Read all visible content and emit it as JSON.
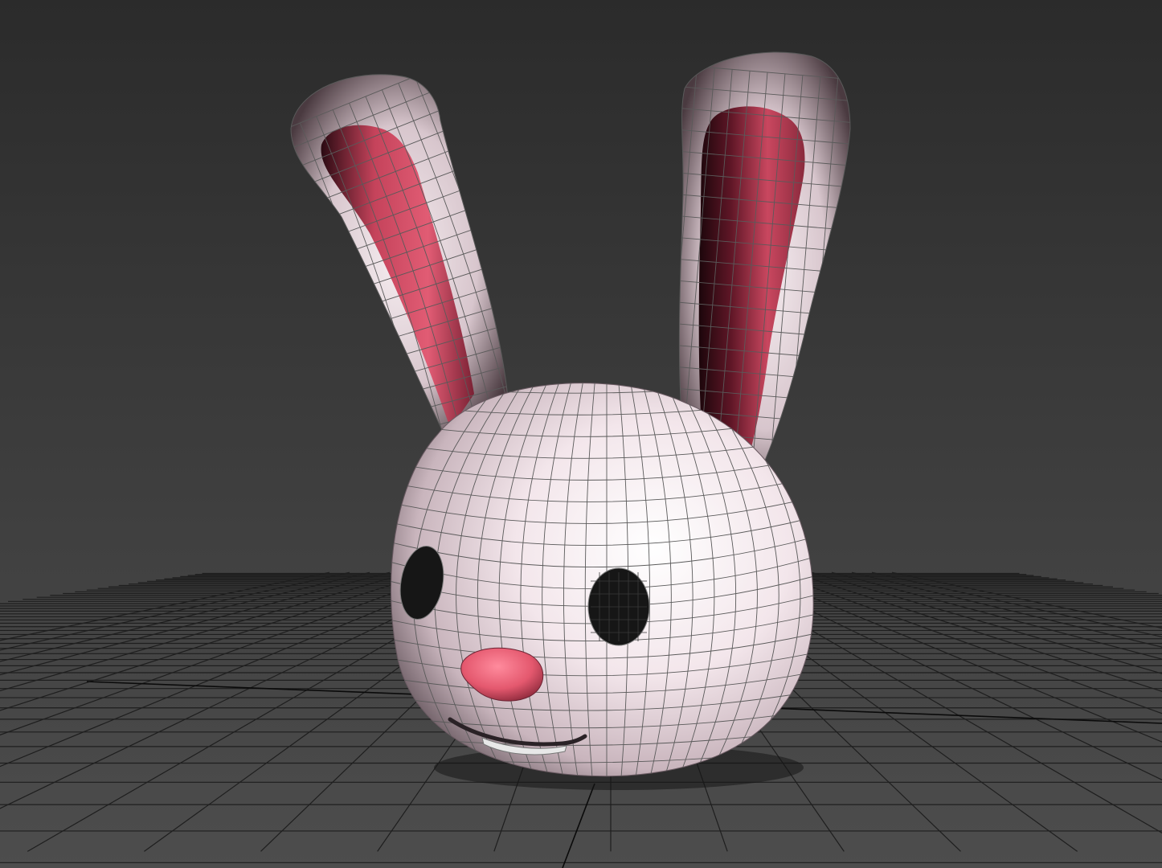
{
  "viewport": {
    "background_top": "#2b2b2b",
    "background_bottom": "#4d4d4d",
    "grid_color": "#1e1e1e",
    "grid_axis_color": "#0a0a0a"
  },
  "model": {
    "subject": "bunny-head",
    "display_mode": "smooth-shaded-with-wireframe",
    "colors": {
      "skin": "#f1e4e9",
      "skin_shadow": "#6a5a62",
      "inner_ear": "#d9536c",
      "inner_ear_dark": "#2a0a12",
      "eye": "#161616",
      "nose": "#e4586e",
      "wire": "#5a5a5a"
    }
  }
}
